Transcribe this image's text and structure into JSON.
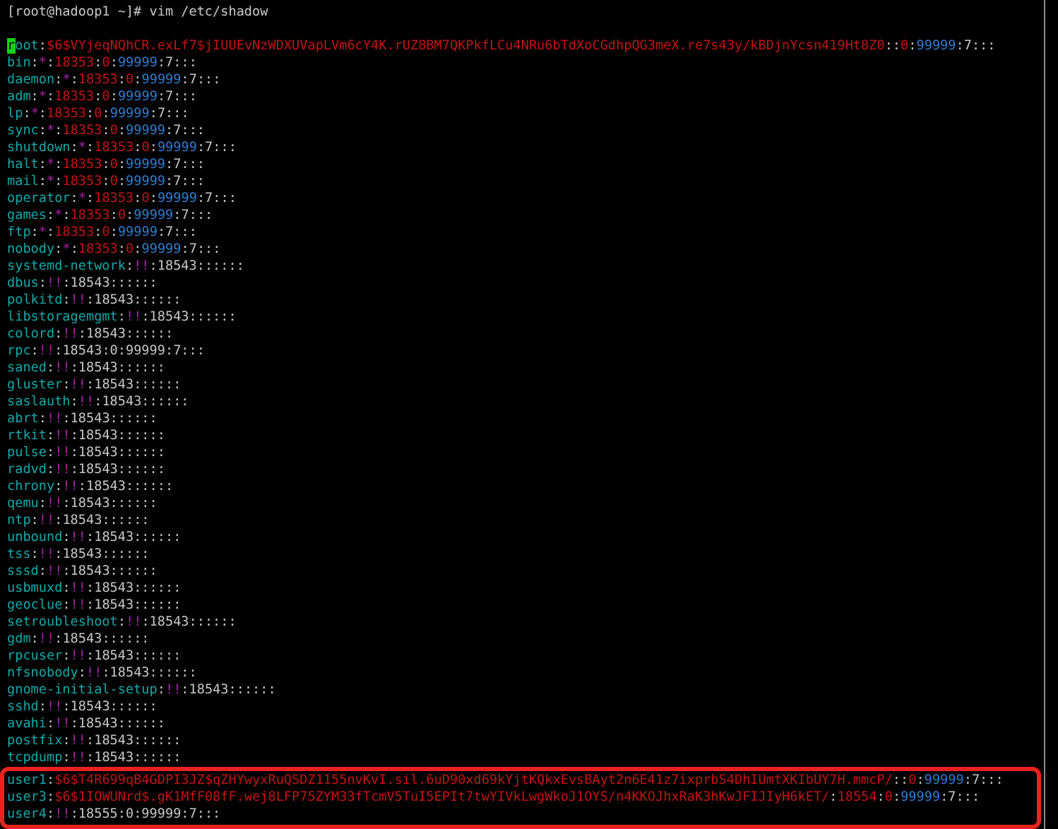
{
  "prompt": "[root@hadoop1 ~]# vim /etc/shadow",
  "lines": [
    {
      "highlighted": false,
      "segments": [
        {
          "kind": "cursor",
          "text": "r"
        },
        {
          "kind": "user",
          "text": "oot"
        },
        {
          "kind": "plain",
          "text": ":"
        },
        {
          "kind": "field",
          "text": "$6$VYjeqNQhCR.exLf7$jIUUEvNzWDXUVapLVm6cY4K.rUZ8BM7QKPkfLCu4NRu6bTdXoCGdhpQG3meX.re7s43y/kBDjnYcsn419Ht8Z0"
        },
        {
          "kind": "plain",
          "text": "::"
        },
        {
          "kind": "field",
          "text": "0"
        },
        {
          "kind": "plain",
          "text": ":"
        },
        {
          "kind": "max",
          "text": "99999"
        },
        {
          "kind": "plain",
          "text": ":7:::"
        }
      ]
    },
    {
      "highlighted": false,
      "segments": [
        {
          "kind": "user",
          "text": "bin"
        },
        {
          "kind": "plain",
          "text": ":"
        },
        {
          "kind": "mark",
          "text": "*"
        },
        {
          "kind": "plain",
          "text": ":"
        },
        {
          "kind": "field",
          "text": "18353"
        },
        {
          "kind": "plain",
          "text": ":"
        },
        {
          "kind": "field",
          "text": "0"
        },
        {
          "kind": "plain",
          "text": ":"
        },
        {
          "kind": "max",
          "text": "99999"
        },
        {
          "kind": "plain",
          "text": ":7:::"
        }
      ]
    },
    {
      "highlighted": false,
      "segments": [
        {
          "kind": "user",
          "text": "daemon"
        },
        {
          "kind": "plain",
          "text": ":"
        },
        {
          "kind": "mark",
          "text": "*"
        },
        {
          "kind": "plain",
          "text": ":"
        },
        {
          "kind": "field",
          "text": "18353"
        },
        {
          "kind": "plain",
          "text": ":"
        },
        {
          "kind": "field",
          "text": "0"
        },
        {
          "kind": "plain",
          "text": ":"
        },
        {
          "kind": "max",
          "text": "99999"
        },
        {
          "kind": "plain",
          "text": ":7:::"
        }
      ]
    },
    {
      "highlighted": false,
      "segments": [
        {
          "kind": "user",
          "text": "adm"
        },
        {
          "kind": "plain",
          "text": ":"
        },
        {
          "kind": "mark",
          "text": "*"
        },
        {
          "kind": "plain",
          "text": ":"
        },
        {
          "kind": "field",
          "text": "18353"
        },
        {
          "kind": "plain",
          "text": ":"
        },
        {
          "kind": "field",
          "text": "0"
        },
        {
          "kind": "plain",
          "text": ":"
        },
        {
          "kind": "max",
          "text": "99999"
        },
        {
          "kind": "plain",
          "text": ":7:::"
        }
      ]
    },
    {
      "highlighted": false,
      "segments": [
        {
          "kind": "user",
          "text": "lp"
        },
        {
          "kind": "plain",
          "text": ":"
        },
        {
          "kind": "mark",
          "text": "*"
        },
        {
          "kind": "plain",
          "text": ":"
        },
        {
          "kind": "field",
          "text": "18353"
        },
        {
          "kind": "plain",
          "text": ":"
        },
        {
          "kind": "field",
          "text": "0"
        },
        {
          "kind": "plain",
          "text": ":"
        },
        {
          "kind": "max",
          "text": "99999"
        },
        {
          "kind": "plain",
          "text": ":7:::"
        }
      ]
    },
    {
      "highlighted": false,
      "segments": [
        {
          "kind": "user",
          "text": "sync"
        },
        {
          "kind": "plain",
          "text": ":"
        },
        {
          "kind": "mark",
          "text": "*"
        },
        {
          "kind": "plain",
          "text": ":"
        },
        {
          "kind": "field",
          "text": "18353"
        },
        {
          "kind": "plain",
          "text": ":"
        },
        {
          "kind": "field",
          "text": "0"
        },
        {
          "kind": "plain",
          "text": ":"
        },
        {
          "kind": "max",
          "text": "99999"
        },
        {
          "kind": "plain",
          "text": ":7:::"
        }
      ]
    },
    {
      "highlighted": false,
      "segments": [
        {
          "kind": "user",
          "text": "shutdown"
        },
        {
          "kind": "plain",
          "text": ":"
        },
        {
          "kind": "mark",
          "text": "*"
        },
        {
          "kind": "plain",
          "text": ":"
        },
        {
          "kind": "field",
          "text": "18353"
        },
        {
          "kind": "plain",
          "text": ":"
        },
        {
          "kind": "field",
          "text": "0"
        },
        {
          "kind": "plain",
          "text": ":"
        },
        {
          "kind": "max",
          "text": "99999"
        },
        {
          "kind": "plain",
          "text": ":7:::"
        }
      ]
    },
    {
      "highlighted": false,
      "segments": [
        {
          "kind": "user",
          "text": "halt"
        },
        {
          "kind": "plain",
          "text": ":"
        },
        {
          "kind": "mark",
          "text": "*"
        },
        {
          "kind": "plain",
          "text": ":"
        },
        {
          "kind": "field",
          "text": "18353"
        },
        {
          "kind": "plain",
          "text": ":"
        },
        {
          "kind": "field",
          "text": "0"
        },
        {
          "kind": "plain",
          "text": ":"
        },
        {
          "kind": "max",
          "text": "99999"
        },
        {
          "kind": "plain",
          "text": ":7:::"
        }
      ]
    },
    {
      "highlighted": false,
      "segments": [
        {
          "kind": "user",
          "text": "mail"
        },
        {
          "kind": "plain",
          "text": ":"
        },
        {
          "kind": "mark",
          "text": "*"
        },
        {
          "kind": "plain",
          "text": ":"
        },
        {
          "kind": "field",
          "text": "18353"
        },
        {
          "kind": "plain",
          "text": ":"
        },
        {
          "kind": "field",
          "text": "0"
        },
        {
          "kind": "plain",
          "text": ":"
        },
        {
          "kind": "max",
          "text": "99999"
        },
        {
          "kind": "plain",
          "text": ":7:::"
        }
      ]
    },
    {
      "highlighted": false,
      "segments": [
        {
          "kind": "user",
          "text": "operator"
        },
        {
          "kind": "plain",
          "text": ":"
        },
        {
          "kind": "mark",
          "text": "*"
        },
        {
          "kind": "plain",
          "text": ":"
        },
        {
          "kind": "field",
          "text": "18353"
        },
        {
          "kind": "plain",
          "text": ":"
        },
        {
          "kind": "field",
          "text": "0"
        },
        {
          "kind": "plain",
          "text": ":"
        },
        {
          "kind": "max",
          "text": "99999"
        },
        {
          "kind": "plain",
          "text": ":7:::"
        }
      ]
    },
    {
      "highlighted": false,
      "segments": [
        {
          "kind": "user",
          "text": "games"
        },
        {
          "kind": "plain",
          "text": ":"
        },
        {
          "kind": "mark",
          "text": "*"
        },
        {
          "kind": "plain",
          "text": ":"
        },
        {
          "kind": "field",
          "text": "18353"
        },
        {
          "kind": "plain",
          "text": ":"
        },
        {
          "kind": "field",
          "text": "0"
        },
        {
          "kind": "plain",
          "text": ":"
        },
        {
          "kind": "max",
          "text": "99999"
        },
        {
          "kind": "plain",
          "text": ":7:::"
        }
      ]
    },
    {
      "highlighted": false,
      "segments": [
        {
          "kind": "user",
          "text": "ftp"
        },
        {
          "kind": "plain",
          "text": ":"
        },
        {
          "kind": "mark",
          "text": "*"
        },
        {
          "kind": "plain",
          "text": ":"
        },
        {
          "kind": "field",
          "text": "18353"
        },
        {
          "kind": "plain",
          "text": ":"
        },
        {
          "kind": "field",
          "text": "0"
        },
        {
          "kind": "plain",
          "text": ":"
        },
        {
          "kind": "max",
          "text": "99999"
        },
        {
          "kind": "plain",
          "text": ":7:::"
        }
      ]
    },
    {
      "highlighted": false,
      "segments": [
        {
          "kind": "user",
          "text": "nobody"
        },
        {
          "kind": "plain",
          "text": ":"
        },
        {
          "kind": "mark",
          "text": "*"
        },
        {
          "kind": "plain",
          "text": ":"
        },
        {
          "kind": "field",
          "text": "18353"
        },
        {
          "kind": "plain",
          "text": ":"
        },
        {
          "kind": "field",
          "text": "0"
        },
        {
          "kind": "plain",
          "text": ":"
        },
        {
          "kind": "max",
          "text": "99999"
        },
        {
          "kind": "plain",
          "text": ":7:::"
        }
      ]
    },
    {
      "highlighted": false,
      "segments": [
        {
          "kind": "user",
          "text": "systemd-network"
        },
        {
          "kind": "plain",
          "text": ":"
        },
        {
          "kind": "mark",
          "text": "!!"
        },
        {
          "kind": "plain",
          "text": ":18543::::::"
        }
      ]
    },
    {
      "highlighted": false,
      "segments": [
        {
          "kind": "user",
          "text": "dbus"
        },
        {
          "kind": "plain",
          "text": ":"
        },
        {
          "kind": "mark",
          "text": "!!"
        },
        {
          "kind": "plain",
          "text": ":18543::::::"
        }
      ]
    },
    {
      "highlighted": false,
      "segments": [
        {
          "kind": "user",
          "text": "polkitd"
        },
        {
          "kind": "plain",
          "text": ":"
        },
        {
          "kind": "mark",
          "text": "!!"
        },
        {
          "kind": "plain",
          "text": ":18543::::::"
        }
      ]
    },
    {
      "highlighted": false,
      "segments": [
        {
          "kind": "user",
          "text": "libstoragemgmt"
        },
        {
          "kind": "plain",
          "text": ":"
        },
        {
          "kind": "mark",
          "text": "!!"
        },
        {
          "kind": "plain",
          "text": ":18543::::::"
        }
      ]
    },
    {
      "highlighted": false,
      "segments": [
        {
          "kind": "user",
          "text": "colord"
        },
        {
          "kind": "plain",
          "text": ":"
        },
        {
          "kind": "mark",
          "text": "!!"
        },
        {
          "kind": "plain",
          "text": ":18543::::::"
        }
      ]
    },
    {
      "highlighted": false,
      "segments": [
        {
          "kind": "user",
          "text": "rpc"
        },
        {
          "kind": "plain",
          "text": ":"
        },
        {
          "kind": "mark",
          "text": "!!"
        },
        {
          "kind": "plain",
          "text": ":18543:0:99999:7:::"
        }
      ]
    },
    {
      "highlighted": false,
      "segments": [
        {
          "kind": "user",
          "text": "saned"
        },
        {
          "kind": "plain",
          "text": ":"
        },
        {
          "kind": "mark",
          "text": "!!"
        },
        {
          "kind": "plain",
          "text": ":18543::::::"
        }
      ]
    },
    {
      "highlighted": false,
      "segments": [
        {
          "kind": "user",
          "text": "gluster"
        },
        {
          "kind": "plain",
          "text": ":"
        },
        {
          "kind": "mark",
          "text": "!!"
        },
        {
          "kind": "plain",
          "text": ":18543::::::"
        }
      ]
    },
    {
      "highlighted": false,
      "segments": [
        {
          "kind": "user",
          "text": "saslauth"
        },
        {
          "kind": "plain",
          "text": ":"
        },
        {
          "kind": "mark",
          "text": "!!"
        },
        {
          "kind": "plain",
          "text": ":18543::::::"
        }
      ]
    },
    {
      "highlighted": false,
      "segments": [
        {
          "kind": "user",
          "text": "abrt"
        },
        {
          "kind": "plain",
          "text": ":"
        },
        {
          "kind": "mark",
          "text": "!!"
        },
        {
          "kind": "plain",
          "text": ":18543::::::"
        }
      ]
    },
    {
      "highlighted": false,
      "segments": [
        {
          "kind": "user",
          "text": "rtkit"
        },
        {
          "kind": "plain",
          "text": ":"
        },
        {
          "kind": "mark",
          "text": "!!"
        },
        {
          "kind": "plain",
          "text": ":18543::::::"
        }
      ]
    },
    {
      "highlighted": false,
      "segments": [
        {
          "kind": "user",
          "text": "pulse"
        },
        {
          "kind": "plain",
          "text": ":"
        },
        {
          "kind": "mark",
          "text": "!!"
        },
        {
          "kind": "plain",
          "text": ":18543::::::"
        }
      ]
    },
    {
      "highlighted": false,
      "segments": [
        {
          "kind": "user",
          "text": "radvd"
        },
        {
          "kind": "plain",
          "text": ":"
        },
        {
          "kind": "mark",
          "text": "!!"
        },
        {
          "kind": "plain",
          "text": ":18543::::::"
        }
      ]
    },
    {
      "highlighted": false,
      "segments": [
        {
          "kind": "user",
          "text": "chrony"
        },
        {
          "kind": "plain",
          "text": ":"
        },
        {
          "kind": "mark",
          "text": "!!"
        },
        {
          "kind": "plain",
          "text": ":18543::::::"
        }
      ]
    },
    {
      "highlighted": false,
      "segments": [
        {
          "kind": "user",
          "text": "qemu"
        },
        {
          "kind": "plain",
          "text": ":"
        },
        {
          "kind": "mark",
          "text": "!!"
        },
        {
          "kind": "plain",
          "text": ":18543::::::"
        }
      ]
    },
    {
      "highlighted": false,
      "segments": [
        {
          "kind": "user",
          "text": "ntp"
        },
        {
          "kind": "plain",
          "text": ":"
        },
        {
          "kind": "mark",
          "text": "!!"
        },
        {
          "kind": "plain",
          "text": ":18543::::::"
        }
      ]
    },
    {
      "highlighted": false,
      "segments": [
        {
          "kind": "user",
          "text": "unbound"
        },
        {
          "kind": "plain",
          "text": ":"
        },
        {
          "kind": "mark",
          "text": "!!"
        },
        {
          "kind": "plain",
          "text": ":18543::::::"
        }
      ]
    },
    {
      "highlighted": false,
      "segments": [
        {
          "kind": "user",
          "text": "tss"
        },
        {
          "kind": "plain",
          "text": ":"
        },
        {
          "kind": "mark",
          "text": "!!"
        },
        {
          "kind": "plain",
          "text": ":18543::::::"
        }
      ]
    },
    {
      "highlighted": false,
      "segments": [
        {
          "kind": "user",
          "text": "sssd"
        },
        {
          "kind": "plain",
          "text": ":"
        },
        {
          "kind": "mark",
          "text": "!!"
        },
        {
          "kind": "plain",
          "text": ":18543::::::"
        }
      ]
    },
    {
      "highlighted": false,
      "segments": [
        {
          "kind": "user",
          "text": "usbmuxd"
        },
        {
          "kind": "plain",
          "text": ":"
        },
        {
          "kind": "mark",
          "text": "!!"
        },
        {
          "kind": "plain",
          "text": ":18543::::::"
        }
      ]
    },
    {
      "highlighted": false,
      "segments": [
        {
          "kind": "user",
          "text": "geoclue"
        },
        {
          "kind": "plain",
          "text": ":"
        },
        {
          "kind": "mark",
          "text": "!!"
        },
        {
          "kind": "plain",
          "text": ":18543::::::"
        }
      ]
    },
    {
      "highlighted": false,
      "segments": [
        {
          "kind": "user",
          "text": "setroubleshoot"
        },
        {
          "kind": "plain",
          "text": ":"
        },
        {
          "kind": "mark",
          "text": "!!"
        },
        {
          "kind": "plain",
          "text": ":18543::::::"
        }
      ]
    },
    {
      "highlighted": false,
      "segments": [
        {
          "kind": "user",
          "text": "gdm"
        },
        {
          "kind": "plain",
          "text": ":"
        },
        {
          "kind": "mark",
          "text": "!!"
        },
        {
          "kind": "plain",
          "text": ":18543::::::"
        }
      ]
    },
    {
      "highlighted": false,
      "segments": [
        {
          "kind": "user",
          "text": "rpcuser"
        },
        {
          "kind": "plain",
          "text": ":"
        },
        {
          "kind": "mark",
          "text": "!!"
        },
        {
          "kind": "plain",
          "text": ":18543::::::"
        }
      ]
    },
    {
      "highlighted": false,
      "segments": [
        {
          "kind": "user",
          "text": "nfsnobody"
        },
        {
          "kind": "plain",
          "text": ":"
        },
        {
          "kind": "mark",
          "text": "!!"
        },
        {
          "kind": "plain",
          "text": ":18543::::::"
        }
      ]
    },
    {
      "highlighted": false,
      "segments": [
        {
          "kind": "user",
          "text": "gnome-initial-setup"
        },
        {
          "kind": "plain",
          "text": ":"
        },
        {
          "kind": "mark",
          "text": "!!"
        },
        {
          "kind": "plain",
          "text": ":18543::::::"
        }
      ]
    },
    {
      "highlighted": false,
      "segments": [
        {
          "kind": "user",
          "text": "sshd"
        },
        {
          "kind": "plain",
          "text": ":"
        },
        {
          "kind": "mark",
          "text": "!!"
        },
        {
          "kind": "plain",
          "text": ":18543::::::"
        }
      ]
    },
    {
      "highlighted": false,
      "segments": [
        {
          "kind": "user",
          "text": "avahi"
        },
        {
          "kind": "plain",
          "text": ":"
        },
        {
          "kind": "mark",
          "text": "!!"
        },
        {
          "kind": "plain",
          "text": ":18543::::::"
        }
      ]
    },
    {
      "highlighted": false,
      "segments": [
        {
          "kind": "user",
          "text": "postfix"
        },
        {
          "kind": "plain",
          "text": ":"
        },
        {
          "kind": "mark",
          "text": "!!"
        },
        {
          "kind": "plain",
          "text": ":18543::::::"
        }
      ]
    },
    {
      "highlighted": false,
      "segments": [
        {
          "kind": "user",
          "text": "tcpdump"
        },
        {
          "kind": "plain",
          "text": ":"
        },
        {
          "kind": "mark",
          "text": "!!"
        },
        {
          "kind": "plain",
          "text": ":18543::::::"
        }
      ]
    },
    {
      "highlighted": true,
      "segments": [
        {
          "kind": "user",
          "text": "user1"
        },
        {
          "kind": "plain",
          "text": ":"
        },
        {
          "kind": "field",
          "text": "$6$T4R699qB4GDPI3JZ$qZHYwyxRuQSDZ1155nvKvI.sil.6uD90xd69kYjtKQkxEvsBAyt2n6E41z7ixprbS4DhIUmtXKIbUY7H.mmcP/"
        },
        {
          "kind": "plain",
          "text": "::"
        },
        {
          "kind": "field",
          "text": "0"
        },
        {
          "kind": "plain",
          "text": ":"
        },
        {
          "kind": "max",
          "text": "99999"
        },
        {
          "kind": "plain",
          "text": ":7:::"
        }
      ]
    },
    {
      "highlighted": true,
      "segments": [
        {
          "kind": "user",
          "text": "user3"
        },
        {
          "kind": "plain",
          "text": ":"
        },
        {
          "kind": "field",
          "text": "$6$1IOWUNrd$.gK1MfF08fF.wej8LFP75ZYM33fTcmV5TuI5EPIt7twYIVkLwgWkoJ1OYS/n4KKOJhxRaK3hKwJFIJIyH6kET/"
        },
        {
          "kind": "plain",
          "text": ":"
        },
        {
          "kind": "field",
          "text": "18554"
        },
        {
          "kind": "plain",
          "text": ":"
        },
        {
          "kind": "field",
          "text": "0"
        },
        {
          "kind": "plain",
          "text": ":"
        },
        {
          "kind": "max",
          "text": "99999"
        },
        {
          "kind": "plain",
          "text": ":7:::"
        }
      ]
    },
    {
      "highlighted": true,
      "segments": [
        {
          "kind": "user",
          "text": "user4"
        },
        {
          "kind": "plain",
          "text": ":"
        },
        {
          "kind": "mark",
          "text": "!!"
        },
        {
          "kind": "plain",
          "text": ":18555:0:99999:7:::"
        }
      ]
    }
  ]
}
